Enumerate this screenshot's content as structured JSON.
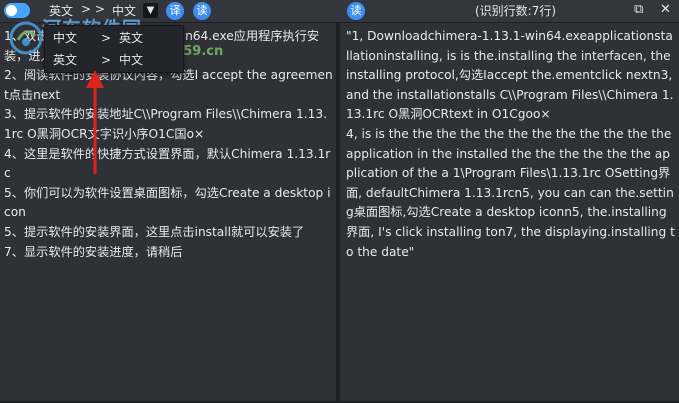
{
  "toolbar": {
    "source_lang": "英文",
    "separator": "> >",
    "target_lang": "中文",
    "caret": "▼",
    "translate_button": "译",
    "read_button_left": "读",
    "read_button_right": "读",
    "line_count": "(识别行数:7行)",
    "pin_icon": "⧉",
    "close_icon": "✕"
  },
  "dropdown": {
    "options": [
      {
        "from": "中文",
        "arrow": ">",
        "to": "英文"
      },
      {
        "from": "英文",
        "arrow": ">",
        "to": "中文"
      }
    ]
  },
  "watermark": {
    "site_name": "河东软件园",
    "url": "www.pc0359.cn"
  },
  "left_pane": {
    "text": "1、双击打开Chimera-1.13.1-win64.exe应用程序执行安装，进入安装界面\n2、阅读软件的安装协议内容，勾选I accept the agreement点击next\n3、提示软件的安装地址C\\\\Program Files\\\\Chimera 1.13.1rc O黑洞OCR文字识小序O1C国o×\n4、这里是软件的快捷方式设置界面，默认Chimera 1.13.1rc\n5、你们可以为软件设置桌面图标，勾选Create a desktop icon\n5、提示软件的安装界面，这里点击install就可以安装了\n7、显示软件的安装进度，请稍后"
  },
  "right_pane": {
    "text": "\"1, Downloadchimera-1.13.1-win64.exeapplicationstallationinstalling, is is the.installing the interfacen, the installing protocol,勾选Iaccept the.ementclick nextn3, and the installationstalls C\\\\Program Files\\\\Chimera 1.13.1rc O黑洞OCRtext in O1Cgoo×\n4, is is the the the the the the the the the the the the application in the installed the the the the the the application of the a 1\\Program Files\\1.13.1rc OSetting界面, defaultChimera 1.13.1rcn5, you can can the.setting桌面图标,勾选Create a desktop iconn5, the.installing界面, I's click installing ton7, the displaying.installing to the date\""
  },
  "colors": {
    "background": "#2b2d33",
    "accent": "#3d8ef0",
    "annotation_arrow": "#e0221c"
  }
}
